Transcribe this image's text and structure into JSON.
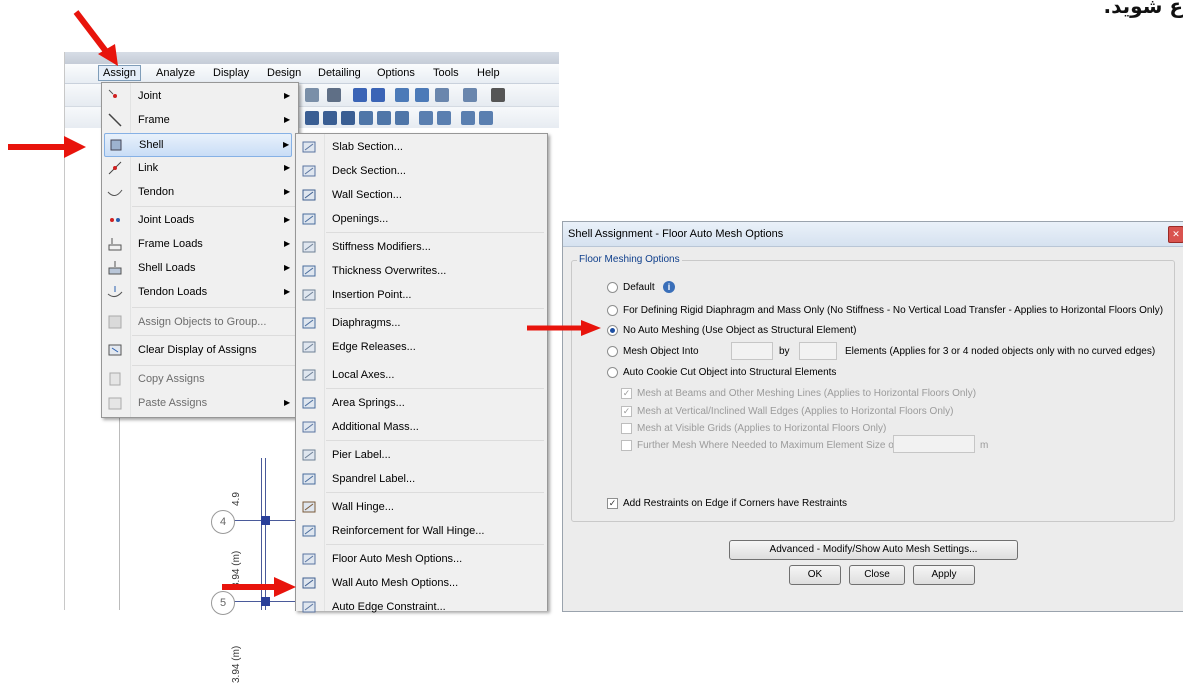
{
  "persian_text": "ع شوید.",
  "menubar": {
    "items": [
      "Assign",
      "Analyze",
      "Display",
      "Design",
      "Detailing",
      "Options",
      "Tools",
      "Help"
    ]
  },
  "assign_menu": {
    "items": [
      {
        "label": "Joint",
        "has_submenu": true
      },
      {
        "label": "Frame",
        "has_submenu": true
      },
      {
        "label": "Shell",
        "has_submenu": true,
        "highlighted": true
      },
      {
        "label": "Link",
        "has_submenu": true
      },
      {
        "label": "Tendon",
        "has_submenu": true
      },
      {
        "label": "Joint Loads",
        "has_submenu": true
      },
      {
        "label": "Frame Loads",
        "has_submenu": true
      },
      {
        "label": "Shell Loads",
        "has_submenu": true
      },
      {
        "label": "Tendon Loads",
        "has_submenu": true
      },
      {
        "label": "Assign Objects to Group...",
        "disabled": true
      },
      {
        "label": "Clear Display of Assigns"
      },
      {
        "label": "Copy Assigns",
        "disabled": true
      },
      {
        "label": "Paste Assigns",
        "has_submenu": true,
        "disabled": true
      }
    ]
  },
  "shell_submenu": {
    "items": [
      "Slab Section...",
      "Deck Section...",
      "Wall Section...",
      "Openings...",
      "Stiffness Modifiers...",
      "Thickness Overwrites...",
      "Insertion Point...",
      "Diaphragms...",
      "Edge Releases...",
      "Local Axes...",
      "Area Springs...",
      "Additional Mass...",
      "Pier Label...",
      "Spandrel Label...",
      "Wall Hinge...",
      "Reinforcement for Wall Hinge...",
      "Floor Auto Mesh Options...",
      "Wall Auto Mesh Options...",
      "Auto Edge Constraint..."
    ]
  },
  "drawing": {
    "grid_bubbles": [
      "4",
      "5"
    ],
    "dimensions": [
      "4.9",
      "3.94 (m)",
      "3.94 (m)"
    ]
  },
  "dialog": {
    "title": "Shell Assignment - Floor Auto Mesh Options",
    "group_label": "Floor Meshing Options",
    "options": {
      "default": "Default",
      "rigid": "For Defining Rigid Diaphragm and Mass Only  (No Stiffness - No Vertical Load Transfer - Applies to Horizontal Floors Only)",
      "no_mesh": "No Auto Meshing  (Use Object as Structural Element)",
      "mesh_into": "Mesh Object Into",
      "by": "by",
      "mesh_into_suffix": "Elements  (Applies for 3 or 4 noded objects only with no curved edges)",
      "cookie_cut": "Auto Cookie Cut Object into Structural Elements",
      "mesh_beams": "Mesh at Beams and Other Meshing Lines  (Applies to Horizontal Floors Only)",
      "mesh_walls": "Mesh at Vertical/Inclined Wall Edges  (Applies to Horizontal Floors Only)",
      "mesh_grids": "Mesh at Visible Grids  (Applies to Horizontal Floors Only)",
      "further_mesh": "Further Mesh Where Needed to Maximum Element Size of",
      "further_unit": "m"
    },
    "selected_option": "no_mesh",
    "restraints_label": "Add Restraints on Edge if Corners have Restraints",
    "advanced_button": "Advanced - Modify/Show Auto Mesh Settings...",
    "ok_button": "OK",
    "close_button": "Close",
    "apply_button": "Apply"
  },
  "colors": {
    "highlight": "#c9ddf6",
    "arrow": "#e8140c",
    "radio_selected": "#1d4fa3"
  }
}
